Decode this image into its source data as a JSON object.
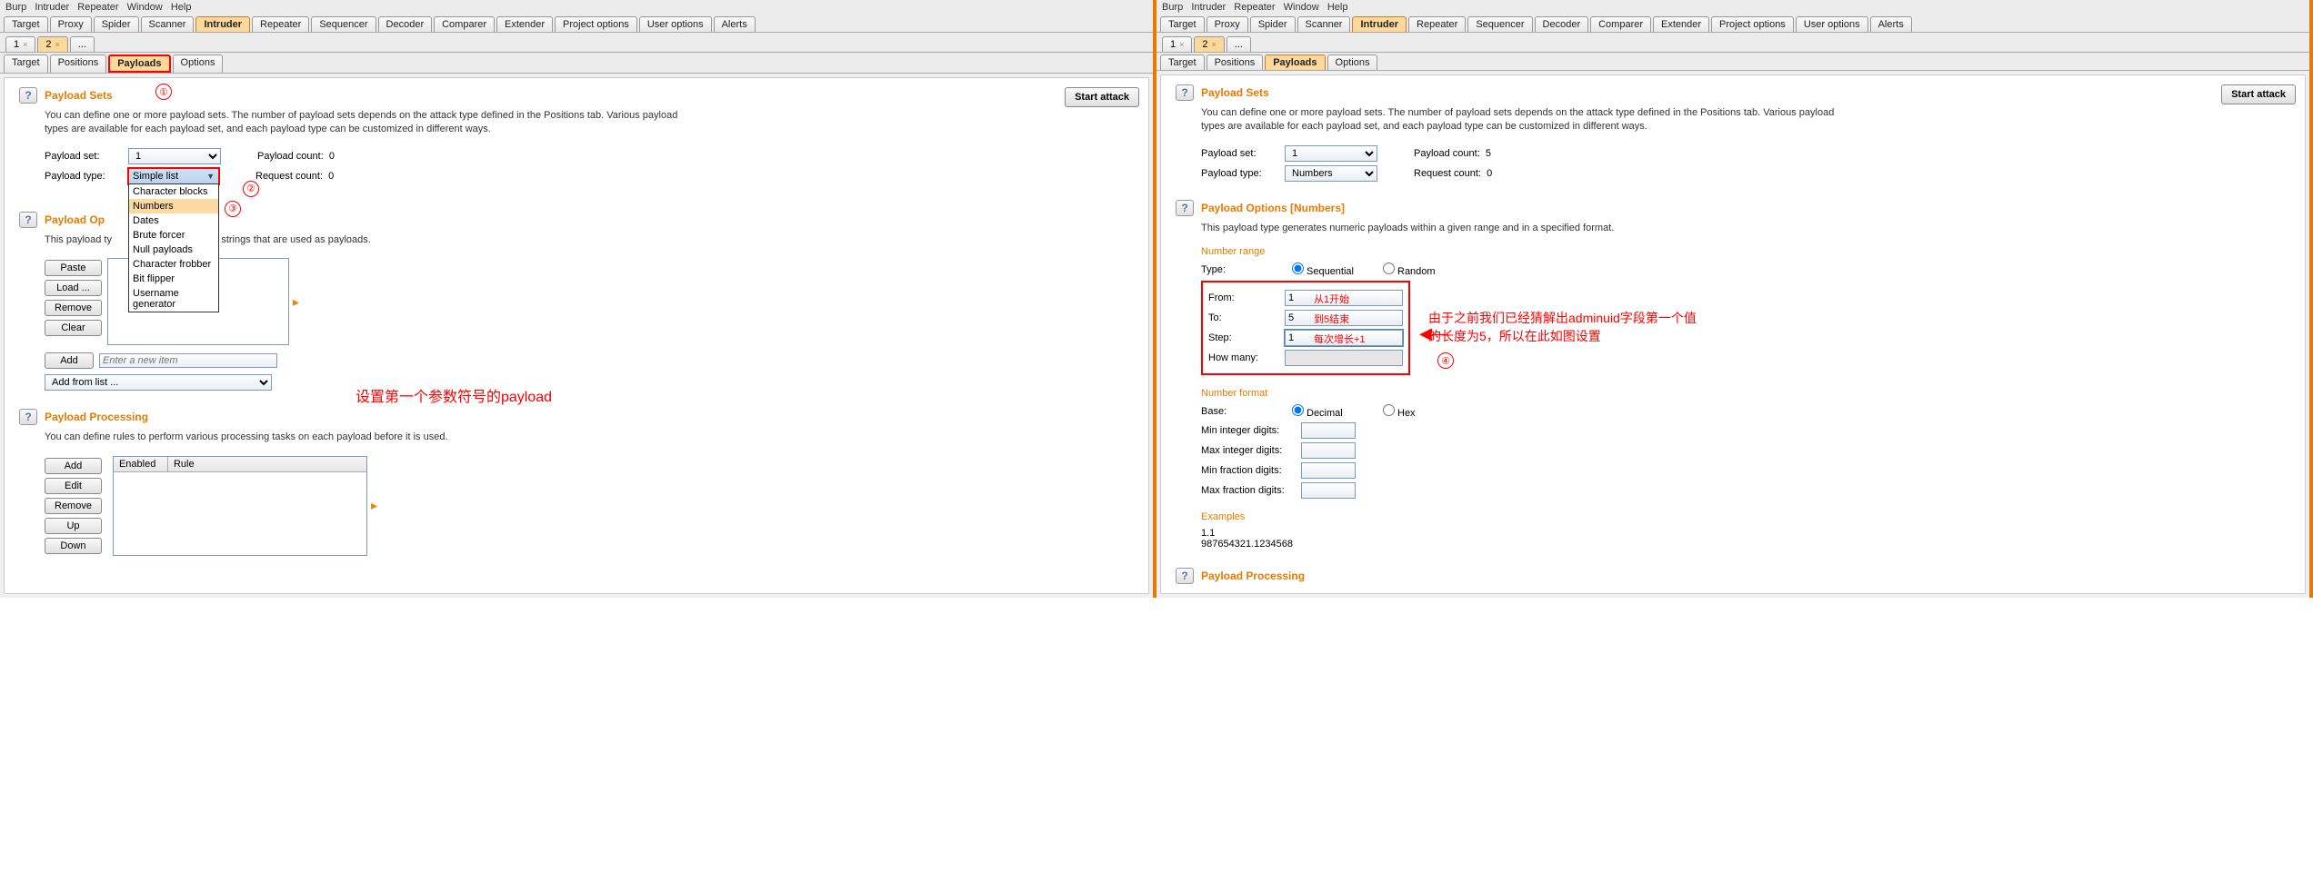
{
  "menubar": [
    "Burp",
    "Intruder",
    "Repeater",
    "Window",
    "Help"
  ],
  "topTabs": [
    "Target",
    "Proxy",
    "Spider",
    "Scanner",
    "Intruder",
    "Repeater",
    "Sequencer",
    "Decoder",
    "Comparer",
    "Extender",
    "Project options",
    "User options",
    "Alerts"
  ],
  "topActive": "Intruder",
  "numTabs": [
    "1",
    "2",
    "..."
  ],
  "subTabs": [
    "Target",
    "Positions",
    "Payloads",
    "Options"
  ],
  "subActive": "Payloads",
  "startAttack": "Start attack",
  "left": {
    "sets": {
      "title": "Payload Sets",
      "desc": "You can define one or more payload sets. The number of payload sets depends on the attack type defined in the Positions tab. Various payload types are available for each payload set, and each payload type can be customized in different ways.",
      "setLbl": "Payload set:",
      "setVal": "1",
      "typeLbl": "Payload type:",
      "typeVal": "Simple list",
      "pcLbl": "Payload count:",
      "pcVal": "0",
      "rcLbl": "Request count:",
      "rcVal": "0"
    },
    "typeOptions": [
      "Character blocks",
      "Numbers",
      "Dates",
      "Brute forcer",
      "Null payloads",
      "Character frobber",
      "Bit flipper",
      "Username generator"
    ],
    "typeSel": "Numbers",
    "opts": {
      "title": "Payload Op",
      "desc": "This payload ty",
      "descTail": "le list of strings that are used as payloads.",
      "btnPaste": "Paste",
      "btnLoad": "Load ...",
      "btnRemove": "Remove",
      "btnClear": "Clear",
      "btnAdd": "Add",
      "placeholder": "Enter a new item",
      "fromList": "Add from list ..."
    },
    "proc": {
      "title": "Payload Processing",
      "desc": "You can define rules to perform various processing tasks on each payload before it is used.",
      "btnAdd": "Add",
      "btnEdit": "Edit",
      "btnRemove": "Remove",
      "btnUp": "Up",
      "btnDown": "Down",
      "colEnabled": "Enabled",
      "colRule": "Rule"
    },
    "annot": {
      "n1": "①",
      "n2": "②",
      "n3": "③",
      "text": "设置第一个参数符号的payload"
    }
  },
  "right": {
    "sets": {
      "title": "Payload Sets",
      "desc": "You can define one or more payload sets. The number of payload sets depends on the attack type defined in the Positions tab. Various payload types are available for each payload set, and each payload type can be customized in different ways.",
      "setLbl": "Payload set:",
      "setVal": "1",
      "typeLbl": "Payload type:",
      "typeVal": "Numbers",
      "pcLbl": "Payload count:",
      "pcVal": "5",
      "rcLbl": "Request count:",
      "rcVal": "0"
    },
    "opts": {
      "title": "Payload Options [Numbers]",
      "desc": "This payload type generates numeric payloads within a given range and in a specified format.",
      "range": {
        "hdr": "Number range",
        "typeLbl": "Type:",
        "seq": "Sequential",
        "rand": "Random",
        "fromLbl": "From:",
        "fromVal": "1",
        "fromNote": "从1开始",
        "toLbl": "To:",
        "toVal": "5",
        "toNote": "到5结束",
        "stepLbl": "Step:",
        "stepVal": "1",
        "stepNote": "每次增长+1",
        "howLbl": "How many:"
      },
      "fmt": {
        "hdr": "Number format",
        "baseLbl": "Base:",
        "dec": "Decimal",
        "hex": "Hex",
        "minInt": "Min integer digits:",
        "maxInt": "Max integer digits:",
        "minFrac": "Min fraction digits:",
        "maxFrac": "Max fraction digits:"
      },
      "ex": {
        "hdr": "Examples",
        "e1": "1.1",
        "e2": "987654321.1234568"
      }
    },
    "proc": {
      "title": "Payload Processing"
    },
    "annot": {
      "n4": "④",
      "text1": "由于之前我们已经猜解出adminuid字段第一个值",
      "text2": "的长度为5，所以在此如图设置"
    }
  }
}
